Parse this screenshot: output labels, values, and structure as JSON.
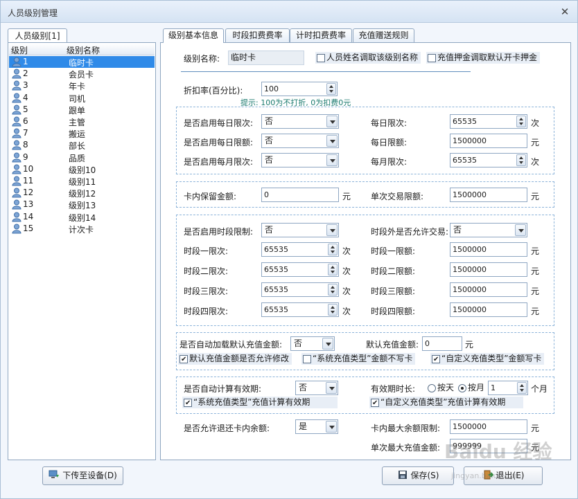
{
  "window": {
    "title": "人员级别管理",
    "close_glyph": "✕"
  },
  "left": {
    "tab_label": "人员级别[1]",
    "col_level": "级别",
    "col_name": "级别名称",
    "rows": [
      {
        "id": "1",
        "name": "临时卡"
      },
      {
        "id": "2",
        "name": "会员卡"
      },
      {
        "id": "3",
        "name": "年卡"
      },
      {
        "id": "4",
        "name": "司机"
      },
      {
        "id": "5",
        "name": "跟单"
      },
      {
        "id": "6",
        "name": "主管"
      },
      {
        "id": "7",
        "name": "搬运"
      },
      {
        "id": "8",
        "name": "部长"
      },
      {
        "id": "9",
        "name": "品质"
      },
      {
        "id": "10",
        "name": "级别10"
      },
      {
        "id": "11",
        "name": "级别11"
      },
      {
        "id": "12",
        "name": "级别12"
      },
      {
        "id": "13",
        "name": "级别13"
      },
      {
        "id": "14",
        "name": "级别14"
      },
      {
        "id": "15",
        "name": "计次卡"
      }
    ],
    "selected_index": 0
  },
  "tabs": [
    "级别基本信息",
    "时段扣费费率",
    "计时扣费费率",
    "充值赠送规则"
  ],
  "basic": {
    "level_name_label": "级别名称:",
    "level_name_value": "临时卡",
    "cb_name_from_staff": "人员姓名调取该级别名称",
    "cb_deposit_default": "充值押金调取默认开卡押金",
    "discount_label": "折扣率(百分比):",
    "discount_value": "100",
    "discount_hint": "提示: 100为不打折, 0为扣费0元"
  },
  "limits": {
    "daily_count_enable_label": "是否启用每日限次:",
    "daily_count_enable_value": "否",
    "daily_amount_enable_label": "是否启用每日限额:",
    "daily_amount_enable_value": "否",
    "monthly_count_enable_label": "是否启用每月限次:",
    "monthly_count_enable_value": "否",
    "daily_count_label": "每日限次:",
    "daily_count_value": "65535",
    "daily_count_unit": "次",
    "daily_amount_label": "每日限额:",
    "daily_amount_value": "1500000",
    "daily_amount_unit": "元",
    "monthly_count_label": "每月限次:",
    "monthly_count_value": "65535",
    "monthly_count_unit": "次"
  },
  "reserve": {
    "keep_label": "卡内保留金额:",
    "keep_value": "0",
    "keep_unit": "元",
    "single_label": "单次交易限额:",
    "single_value": "1500000",
    "single_unit": "元"
  },
  "periods": {
    "enable_label": "是否启用时段限制:",
    "enable_value": "否",
    "outside_label": "时段外是否允许交易:",
    "outside_value": "否",
    "p1_count_label": "时段一限次:",
    "p1_count_value": "65535",
    "p2_count_label": "时段二限次:",
    "p2_count_value": "65535",
    "p3_count_label": "时段三限次:",
    "p3_count_value": "65535",
    "p4_count_label": "时段四限次:",
    "p4_count_value": "65535",
    "p1_amount_label": "时段一限额:",
    "p1_amount_value": "1500000",
    "p2_amount_label": "时段二限额:",
    "p2_amount_value": "1500000",
    "p3_amount_label": "时段三限额:",
    "p3_amount_value": "1500000",
    "p4_amount_label": "时段四限额:",
    "p4_amount_value": "1500000",
    "unit_count": "次",
    "unit_amount": "元"
  },
  "recharge": {
    "auto_load_label": "是否自动加载默认充值金额:",
    "auto_load_value": "否",
    "default_amount_label": "默认充值金额:",
    "default_amount_value": "0",
    "default_amount_unit": "元",
    "cb_allow_modify": "默认充值金额是否允许修改",
    "cb_allow_modify_checked": true,
    "cb_system_type": "“系统充值类型”金额不写卡",
    "cb_system_type_checked": false,
    "cb_custom_type": "“自定义充值类型”金额写卡",
    "cb_custom_type_checked": true
  },
  "validity": {
    "auto_calc_label": "是否自动计算有效期:",
    "auto_calc_value": "否",
    "duration_label": "有效期时长:",
    "radio_day": "按天",
    "radio_month": "按月",
    "selected_mode": "按月",
    "duration_value": "1",
    "duration_unit": "个月",
    "cb_system_valid": "“系统充值类型”充值计算有效期",
    "cb_custom_valid": "“自定义充值类型”充值计算有效期"
  },
  "refund": {
    "allow_label": "是否允许退还卡内余额:",
    "allow_value": "是",
    "max_balance_label": "卡内最大余额限制:",
    "max_balance_value": "1500000",
    "max_balance_unit": "元",
    "max_single_label": "单次最大充值金额:",
    "max_single_value": "999999",
    "max_single_unit": "元"
  },
  "buttons": {
    "download": "下传至设备(D)",
    "save": "保存(S)",
    "exit": "退出(E)"
  },
  "watermark": {
    "brand": "Baidu 经验",
    "url": "jingyan.baidu.com"
  }
}
